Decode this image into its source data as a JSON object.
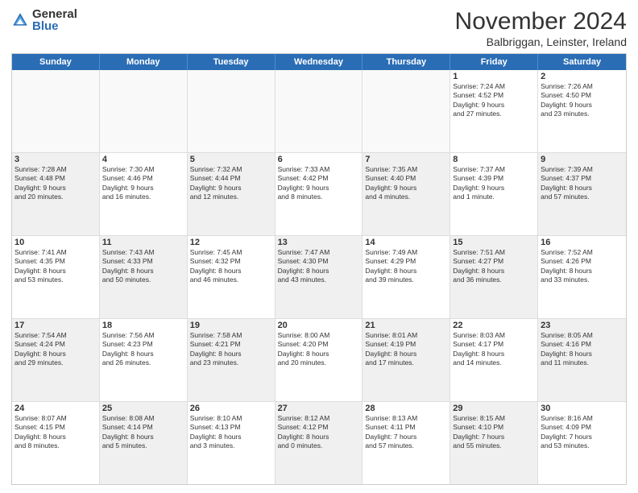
{
  "logo": {
    "general": "General",
    "blue": "Blue"
  },
  "header": {
    "month": "November 2024",
    "location": "Balbriggan, Leinster, Ireland"
  },
  "days": [
    "Sunday",
    "Monday",
    "Tuesday",
    "Wednesday",
    "Thursday",
    "Friday",
    "Saturday"
  ],
  "rows": [
    [
      {
        "day": "",
        "empty": true
      },
      {
        "day": "",
        "empty": true
      },
      {
        "day": "",
        "empty": true
      },
      {
        "day": "",
        "empty": true
      },
      {
        "day": "",
        "empty": true
      },
      {
        "day": "1",
        "lines": [
          "Sunrise: 7:24 AM",
          "Sunset: 4:52 PM",
          "Daylight: 9 hours",
          "and 27 minutes."
        ]
      },
      {
        "day": "2",
        "lines": [
          "Sunrise: 7:26 AM",
          "Sunset: 4:50 PM",
          "Daylight: 9 hours",
          "and 23 minutes."
        ]
      }
    ],
    [
      {
        "day": "3",
        "shaded": true,
        "lines": [
          "Sunrise: 7:28 AM",
          "Sunset: 4:48 PM",
          "Daylight: 9 hours",
          "and 20 minutes."
        ]
      },
      {
        "day": "4",
        "lines": [
          "Sunrise: 7:30 AM",
          "Sunset: 4:46 PM",
          "Daylight: 9 hours",
          "and 16 minutes."
        ]
      },
      {
        "day": "5",
        "shaded": true,
        "lines": [
          "Sunrise: 7:32 AM",
          "Sunset: 4:44 PM",
          "Daylight: 9 hours",
          "and 12 minutes."
        ]
      },
      {
        "day": "6",
        "lines": [
          "Sunrise: 7:33 AM",
          "Sunset: 4:42 PM",
          "Daylight: 9 hours",
          "and 8 minutes."
        ]
      },
      {
        "day": "7",
        "shaded": true,
        "lines": [
          "Sunrise: 7:35 AM",
          "Sunset: 4:40 PM",
          "Daylight: 9 hours",
          "and 4 minutes."
        ]
      },
      {
        "day": "8",
        "lines": [
          "Sunrise: 7:37 AM",
          "Sunset: 4:39 PM",
          "Daylight: 9 hours",
          "and 1 minute."
        ]
      },
      {
        "day": "9",
        "shaded": true,
        "lines": [
          "Sunrise: 7:39 AM",
          "Sunset: 4:37 PM",
          "Daylight: 8 hours",
          "and 57 minutes."
        ]
      }
    ],
    [
      {
        "day": "10",
        "lines": [
          "Sunrise: 7:41 AM",
          "Sunset: 4:35 PM",
          "Daylight: 8 hours",
          "and 53 minutes."
        ]
      },
      {
        "day": "11",
        "shaded": true,
        "lines": [
          "Sunrise: 7:43 AM",
          "Sunset: 4:33 PM",
          "Daylight: 8 hours",
          "and 50 minutes."
        ]
      },
      {
        "day": "12",
        "lines": [
          "Sunrise: 7:45 AM",
          "Sunset: 4:32 PM",
          "Daylight: 8 hours",
          "and 46 minutes."
        ]
      },
      {
        "day": "13",
        "shaded": true,
        "lines": [
          "Sunrise: 7:47 AM",
          "Sunset: 4:30 PM",
          "Daylight: 8 hours",
          "and 43 minutes."
        ]
      },
      {
        "day": "14",
        "lines": [
          "Sunrise: 7:49 AM",
          "Sunset: 4:29 PM",
          "Daylight: 8 hours",
          "and 39 minutes."
        ]
      },
      {
        "day": "15",
        "shaded": true,
        "lines": [
          "Sunrise: 7:51 AM",
          "Sunset: 4:27 PM",
          "Daylight: 8 hours",
          "and 36 minutes."
        ]
      },
      {
        "day": "16",
        "lines": [
          "Sunrise: 7:52 AM",
          "Sunset: 4:26 PM",
          "Daylight: 8 hours",
          "and 33 minutes."
        ]
      }
    ],
    [
      {
        "day": "17",
        "shaded": true,
        "lines": [
          "Sunrise: 7:54 AM",
          "Sunset: 4:24 PM",
          "Daylight: 8 hours",
          "and 29 minutes."
        ]
      },
      {
        "day": "18",
        "lines": [
          "Sunrise: 7:56 AM",
          "Sunset: 4:23 PM",
          "Daylight: 8 hours",
          "and 26 minutes."
        ]
      },
      {
        "day": "19",
        "shaded": true,
        "lines": [
          "Sunrise: 7:58 AM",
          "Sunset: 4:21 PM",
          "Daylight: 8 hours",
          "and 23 minutes."
        ]
      },
      {
        "day": "20",
        "lines": [
          "Sunrise: 8:00 AM",
          "Sunset: 4:20 PM",
          "Daylight: 8 hours",
          "and 20 minutes."
        ]
      },
      {
        "day": "21",
        "shaded": true,
        "lines": [
          "Sunrise: 8:01 AM",
          "Sunset: 4:19 PM",
          "Daylight: 8 hours",
          "and 17 minutes."
        ]
      },
      {
        "day": "22",
        "lines": [
          "Sunrise: 8:03 AM",
          "Sunset: 4:17 PM",
          "Daylight: 8 hours",
          "and 14 minutes."
        ]
      },
      {
        "day": "23",
        "shaded": true,
        "lines": [
          "Sunrise: 8:05 AM",
          "Sunset: 4:16 PM",
          "Daylight: 8 hours",
          "and 11 minutes."
        ]
      }
    ],
    [
      {
        "day": "24",
        "lines": [
          "Sunrise: 8:07 AM",
          "Sunset: 4:15 PM",
          "Daylight: 8 hours",
          "and 8 minutes."
        ]
      },
      {
        "day": "25",
        "shaded": true,
        "lines": [
          "Sunrise: 8:08 AM",
          "Sunset: 4:14 PM",
          "Daylight: 8 hours",
          "and 5 minutes."
        ]
      },
      {
        "day": "26",
        "lines": [
          "Sunrise: 8:10 AM",
          "Sunset: 4:13 PM",
          "Daylight: 8 hours",
          "and 3 minutes."
        ]
      },
      {
        "day": "27",
        "shaded": true,
        "lines": [
          "Sunrise: 8:12 AM",
          "Sunset: 4:12 PM",
          "Daylight: 8 hours",
          "and 0 minutes."
        ]
      },
      {
        "day": "28",
        "lines": [
          "Sunrise: 8:13 AM",
          "Sunset: 4:11 PM",
          "Daylight: 7 hours",
          "and 57 minutes."
        ]
      },
      {
        "day": "29",
        "shaded": true,
        "lines": [
          "Sunrise: 8:15 AM",
          "Sunset: 4:10 PM",
          "Daylight: 7 hours",
          "and 55 minutes."
        ]
      },
      {
        "day": "30",
        "lines": [
          "Sunrise: 8:16 AM",
          "Sunset: 4:09 PM",
          "Daylight: 7 hours",
          "and 53 minutes."
        ]
      }
    ]
  ]
}
